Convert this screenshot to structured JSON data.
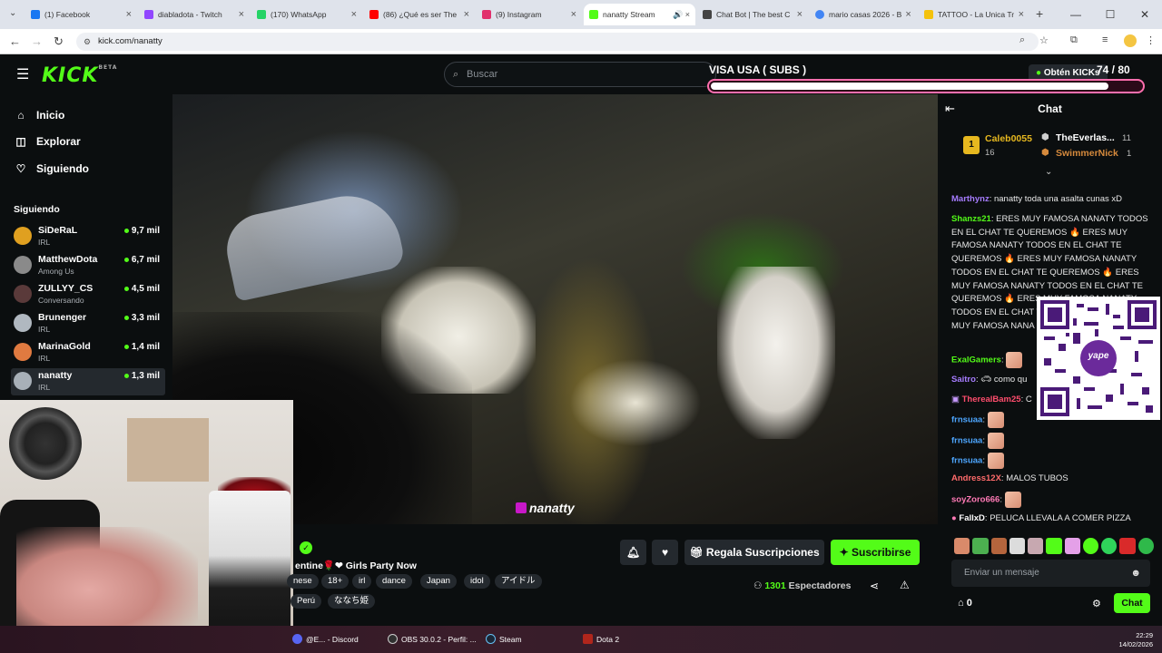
{
  "browser": {
    "tabs": [
      {
        "label": "(1) Facebook",
        "color": "#1877f2",
        "active": false
      },
      {
        "label": "diabladota - Twitch",
        "color": "#9146ff",
        "active": false
      },
      {
        "label": "(170) WhatsApp",
        "color": "#25d366",
        "active": false
      },
      {
        "label": "(86) ¿Qué es ser The",
        "color": "#ff0000",
        "active": false
      },
      {
        "label": "(9) Instagram",
        "color": "#e1306c",
        "active": false
      },
      {
        "label": "nanatty Stream",
        "color": "#53fc18",
        "active": true
      },
      {
        "label": "Chat Bot | The best C",
        "color": "#444444",
        "active": false
      },
      {
        "label": "mario casas 2026 - B",
        "color": "#4285f4",
        "active": false
      },
      {
        "label": "TATTOO - La Unica Tr",
        "color": "#f4c20d",
        "active": false
      }
    ],
    "url": "kick.com/nanatty"
  },
  "header": {
    "logo": "KICK",
    "logo_badge": "BETA",
    "search_placeholder": "Buscar",
    "get_kicks": "Obtén KICKs"
  },
  "sidebar": {
    "nav": [
      {
        "label": "Inicio",
        "icon": "home-icon"
      },
      {
        "label": "Explorar",
        "icon": "compass-icon"
      },
      {
        "label": "Siguiendo",
        "icon": "heart-icon"
      }
    ],
    "following_title": "Siguiendo",
    "channels": [
      {
        "name": "SiDeRaL",
        "category": "IRL",
        "viewers": "9,7 mil",
        "color": "#e0a020"
      },
      {
        "name": "MatthewDota",
        "category": "Among Us",
        "viewers": "6,7 mil",
        "color": "#8a8a8a"
      },
      {
        "name": "ZULLYY_CS",
        "category": "Conversando",
        "viewers": "4,5 mil",
        "color": "#5a3a3a"
      },
      {
        "name": "Brunenger",
        "category": "IRL",
        "viewers": "3,3 mil",
        "color": "#b0b8c0"
      },
      {
        "name": "MarinaGold",
        "category": "IRL",
        "viewers": "1,4 mil",
        "color": "#e07a40"
      },
      {
        "name": "nanatty",
        "category": "IRL",
        "viewers": "1,3 mil",
        "color": "#a8b0b8"
      }
    ]
  },
  "overlay": {
    "goal_title": "VISA USA ( SUBS )",
    "goal_current": 74,
    "goal_total": 80,
    "goal_count_text": "74  / 80",
    "watermark": "nanatty"
  },
  "stream": {
    "title": "entine🌹❤ Girls Party Now",
    "tags": [
      "nese",
      "18+",
      "irl",
      "dance",
      "Japan",
      "idol",
      "アイドル",
      "Perú",
      "ななち姫"
    ],
    "viewers_count": "1301",
    "viewers_label": "Espectadores",
    "gift_subs_label": "Regala Suscripciones",
    "subscribe_label": "Suscribirse"
  },
  "chat": {
    "title": "Chat",
    "leaderboard": {
      "first": {
        "rank": "1",
        "name": "Caleb0055",
        "count": "16"
      },
      "second": {
        "name": "TheEverlas...",
        "count": "11"
      },
      "third": {
        "name": "SwimmerNick",
        "count": "1"
      }
    },
    "messages": [
      {
        "user": "Marthynz",
        "color": "#a67cff",
        "text": "nanatty toda una asalta cunas xD"
      },
      {
        "user": "Shanzs21",
        "color": "#53fc18",
        "text": "ERES MUY FAMOSA NANATY TODOS EN EL CHAT TE QUEREMOS 🔥 ERES MUY FAMOSA NANATY TODOS EN EL CHAT TE QUEREMOS 🔥 ERES MUY FAMOSA NANATY TODOS EN EL CHAT TE QUEREMOS 🔥 ERES MUY FAMOSA NANATY TODOS EN EL CHAT TE QUEREMOS 🔥 ERES MUY FAMOSA NANATY TODOS EN EL CHAT TE QUEREMOS 🔥 ERES MUY FAMOSA NANA QUEREMOS 🔥"
      },
      {
        "user": "ExalGamers",
        "color": "#53fc18",
        "text": ""
      },
      {
        "user": "Saitro",
        "color": "#a67cff",
        "text": "como qu"
      },
      {
        "user": "TherealBam25",
        "color": "#ff4d6d",
        "text": "C"
      },
      {
        "user": "frnsuaa",
        "color": "#4da6ff",
        "text": ""
      },
      {
        "user": "frnsuaa",
        "color": "#4da6ff",
        "text": ""
      },
      {
        "user": "frnsuaa",
        "color": "#4da6ff",
        "text": ""
      },
      {
        "user": "Andress12X",
        "color": "#ff6b6b",
        "text": "MALOS TUBOS"
      },
      {
        "user": "soyZoro666",
        "color": "#ff7ab6",
        "text": ""
      },
      {
        "user": "FallxD",
        "color": "#ffffff",
        "text": "PELUCA LLEVALA A COMER PIZZA"
      }
    ],
    "input_placeholder": "Enviar un mensaje",
    "kicks_balance": "0",
    "send_label": "Chat",
    "qr_label": "yape"
  },
  "taskbar": {
    "items": [
      {
        "label": "@E... - Discord",
        "color": "#5865f2"
      },
      {
        "label": "OBS 30.0.2 - Perfil: ...",
        "color": "#303030"
      },
      {
        "label": "Steam",
        "color": "#1b2838"
      },
      {
        "label": "Dota 2",
        "color": "#b0261c"
      }
    ],
    "time": "22:29",
    "date": "14/02/2026"
  },
  "colors": {
    "accent": "#53fc18",
    "background": "#0b0e0f",
    "goal_border": "#ff6fae"
  }
}
